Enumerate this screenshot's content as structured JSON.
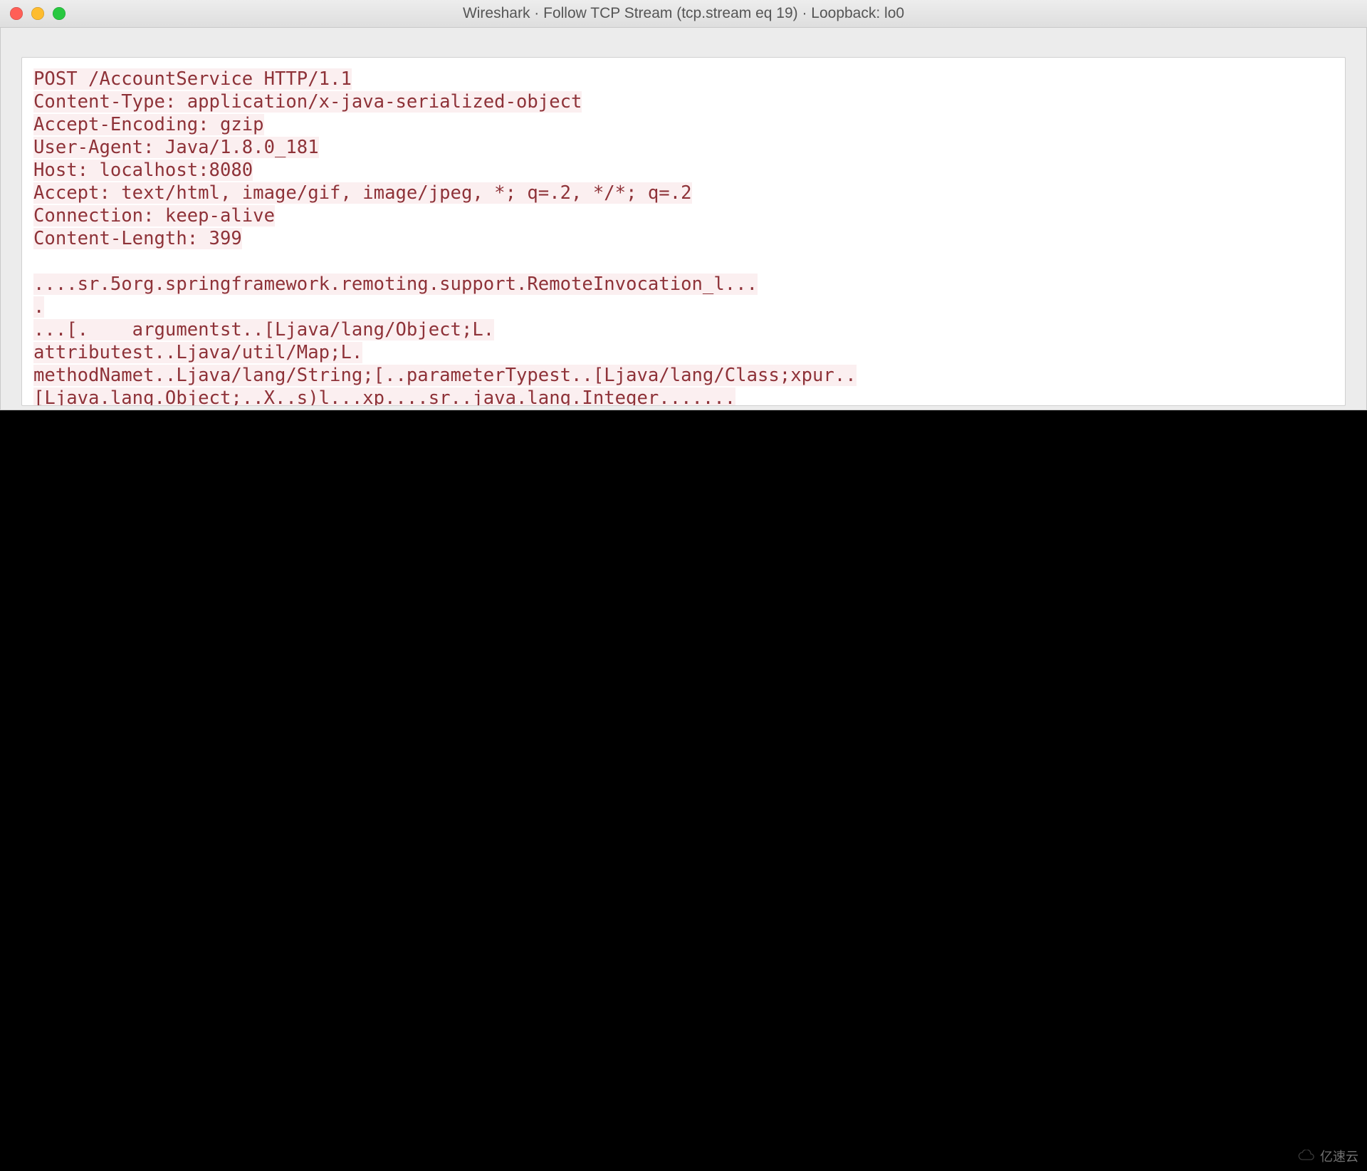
{
  "window": {
    "title": "Wireshark · Follow TCP Stream (tcp.stream eq 19) · Loopback: lo0"
  },
  "stream": {
    "lines": [
      "POST /AccountService HTTP/1.1",
      "Content-Type: application/x-java-serialized-object",
      "Accept-Encoding: gzip",
      "User-Agent: Java/1.8.0_181",
      "Host: localhost:8080",
      "Accept: text/html, image/gif, image/jpeg, *; q=.2, */*; q=.2",
      "Connection: keep-alive",
      "Content-Length: 399",
      "",
      "....sr.5org.springframework.remoting.support.RemoteInvocation_l...",
      ".",
      "...[.    argumentst..[Ljava/lang/Object;L.",
      "attributest..Ljava/util/Map;L.",
      "methodNamet..Ljava/lang/String;[..parameterTypest..[Ljava/lang/Class;xpur..",
      "[Ljava.lang.Object;..X..s)l...xp....sr..java.lang.Integer......."
    ]
  },
  "watermark": {
    "text": "亿速云"
  }
}
